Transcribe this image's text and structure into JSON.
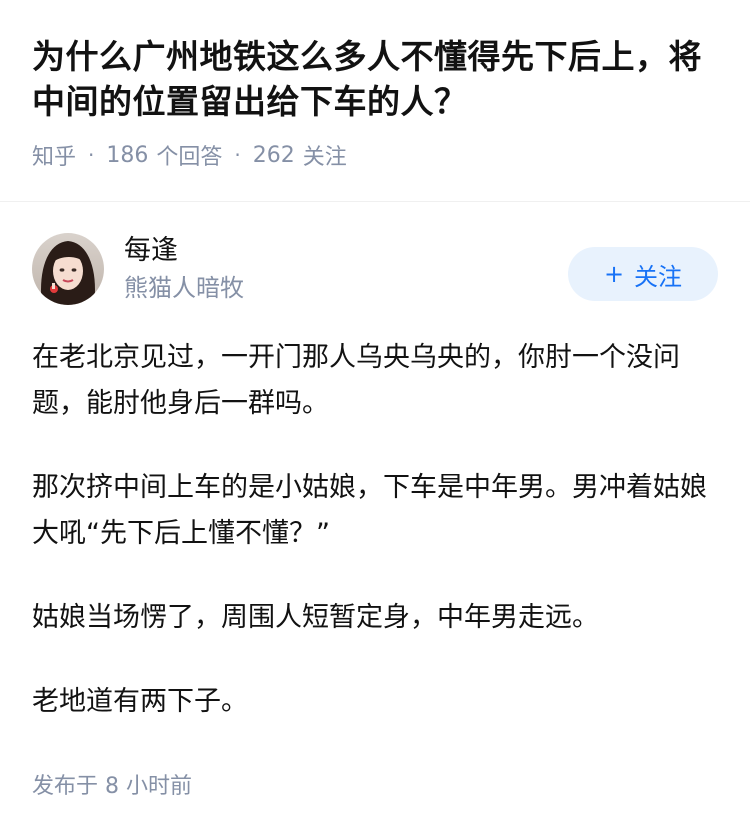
{
  "question": {
    "title": "为什么广州地铁这么多人不懂得先下后上，将中间的位置留出给下车的人？",
    "source": "知乎",
    "answer_count": "186",
    "answer_label": "个回答",
    "follower_count": "262",
    "follower_label": "关注"
  },
  "author": {
    "name": "每逢",
    "bio": "熊猫人暗牧",
    "follow_label": "关注",
    "follow_icon": "plus-icon"
  },
  "answer": {
    "paragraphs": [
      "在老北京见过，一开门那人乌央乌央的，你肘一个没问题，能肘他身后一群吗。",
      "那次挤中间上车的是小姑娘，下车是中年男。男冲着姑娘大吼“先下后上懂不懂？”",
      "姑娘当场愣了，周围人短暂定身，中年男走远。",
      "老地道有两下子。"
    ],
    "publish_label": "发布于",
    "publish_time": "8 小时前"
  },
  "colors": {
    "accent": "#1772f6",
    "accent_bg": "#e8f2fd",
    "meta_gray": "#8590a6",
    "text": "#121212"
  }
}
